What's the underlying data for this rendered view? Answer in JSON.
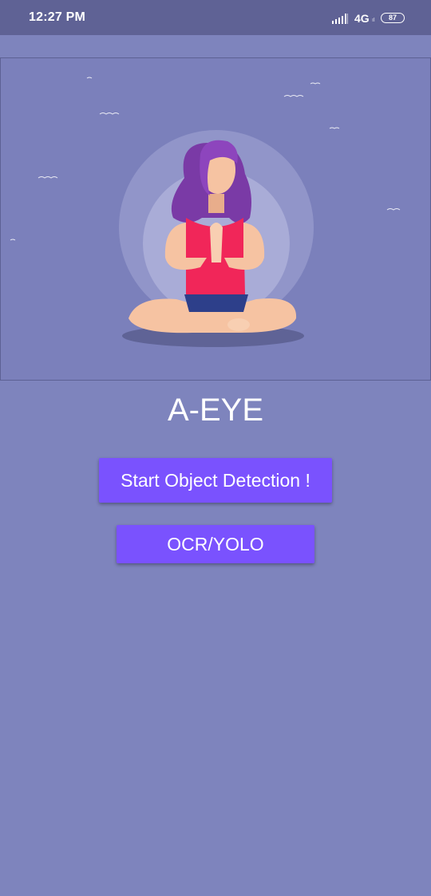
{
  "status_bar": {
    "time": "12:27 PM",
    "network": "4G",
    "network_sub": "ıl",
    "battery": "87",
    "signal_icon": "signal-bars-icon",
    "battery_icon": "battery-icon"
  },
  "hero": {
    "illustration": "meditating-woman-illustration"
  },
  "app": {
    "title": "A-EYE"
  },
  "buttons": {
    "start_detection": "Start Object Detection !",
    "ocr_yolo": "OCR/YOLO"
  },
  "colors": {
    "background": "#7e84bd",
    "status_bar": "#5f6295",
    "button": "#7a52fe",
    "text": "#ffffff"
  }
}
